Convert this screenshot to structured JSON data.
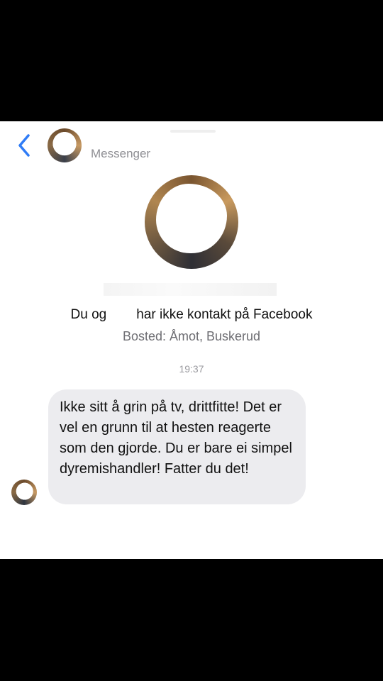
{
  "header": {
    "subtitle": "Messenger",
    "back_icon": "chevron-left-icon",
    "accent_color": "#2f7cf6"
  },
  "profile": {
    "contact_prefix": "Du og",
    "contact_suffix": "har ikke kontakt på Facebook",
    "location": "Bosted: Åmot, Buskerud"
  },
  "thread": {
    "timestamp": "19:37",
    "messages": [
      {
        "text": "Ikke sitt å grin på tv, drittfitte! Det er vel en grunn til at hesten reagerte som den gjorde. Du er bare ei simpel dyremishandler! Fatter du det!"
      }
    ]
  }
}
